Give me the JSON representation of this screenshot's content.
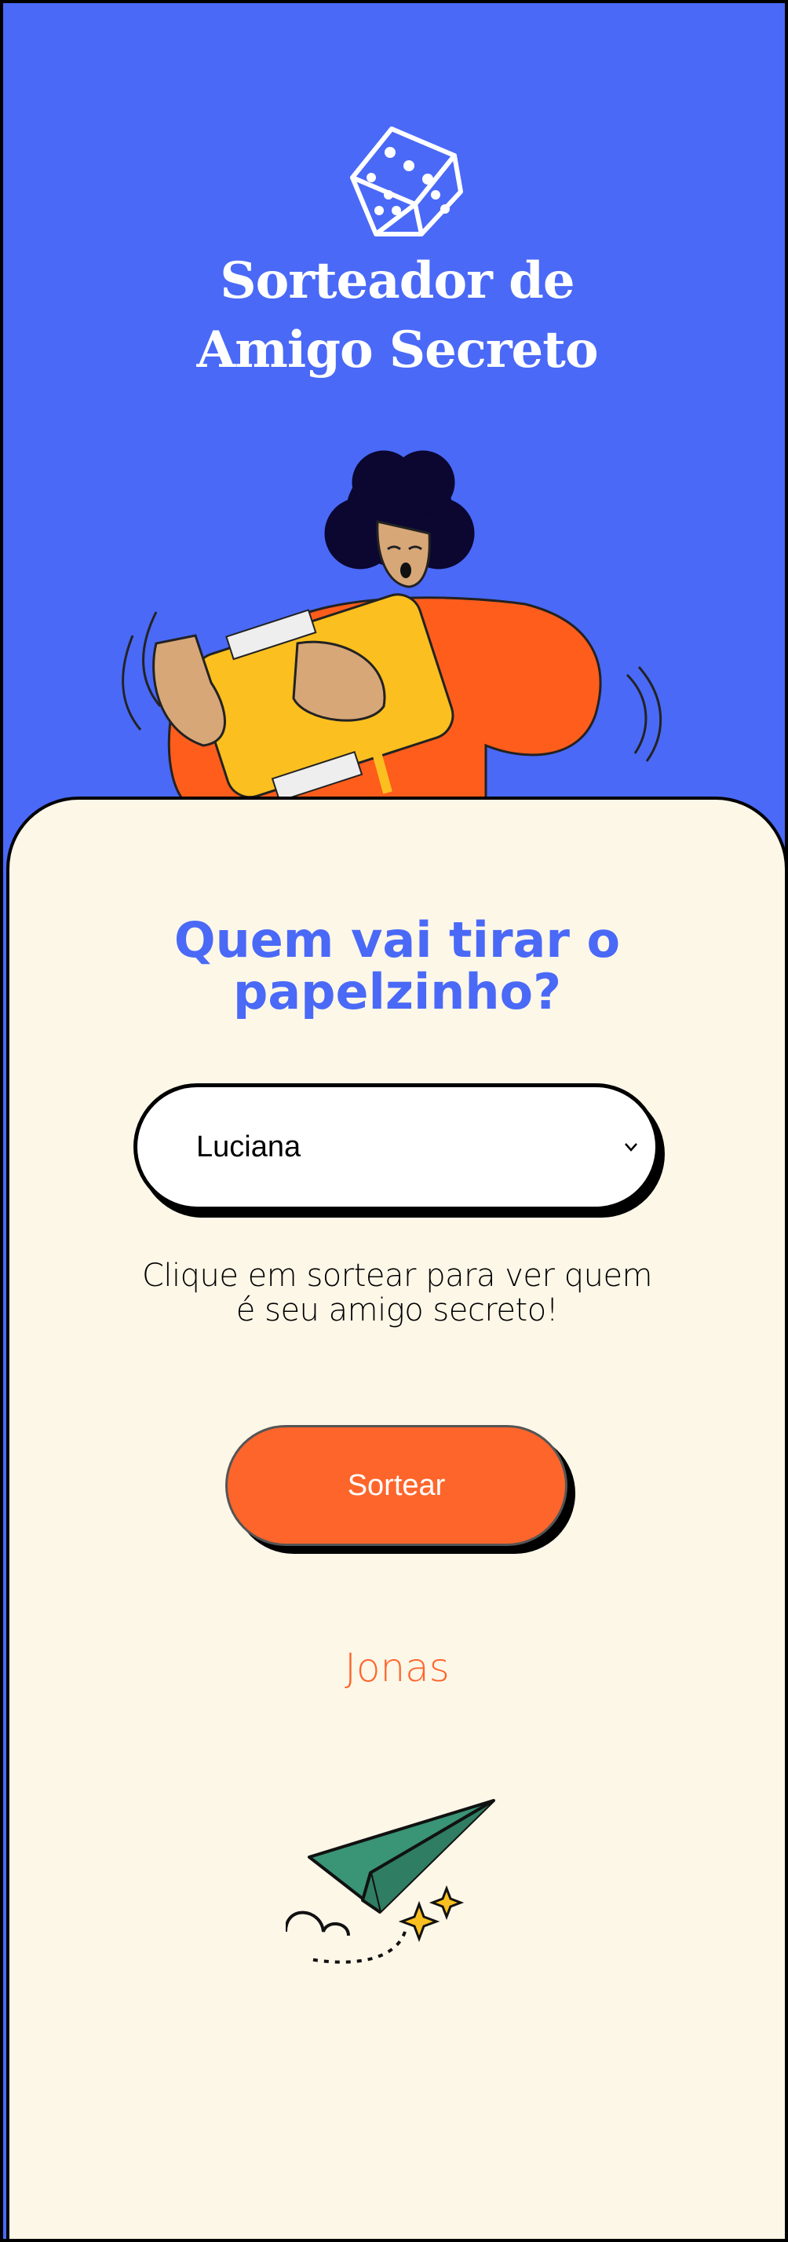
{
  "header": {
    "title_line1": "Sorteador de",
    "title_line2": "Amigo Secreto",
    "logo_icon": "dice-icon",
    "background_color": "#4a69f7"
  },
  "main": {
    "question_line1": "Quem vai tirar o",
    "question_line2": "papelzinho?",
    "select": {
      "selected_value": "Luciana",
      "icon": "chevron-down-icon"
    },
    "hint_line1": "Clique em sortear para ver quem",
    "hint_line2": "é seu amigo secreto!",
    "draw_button_label": "Sortear",
    "result_name": "Jonas",
    "decoration_icon": "paper-plane-icon"
  },
  "colors": {
    "primary_blue": "#4a69f7",
    "accent_orange": "#fe652b",
    "card_background": "#fdf7e8"
  }
}
